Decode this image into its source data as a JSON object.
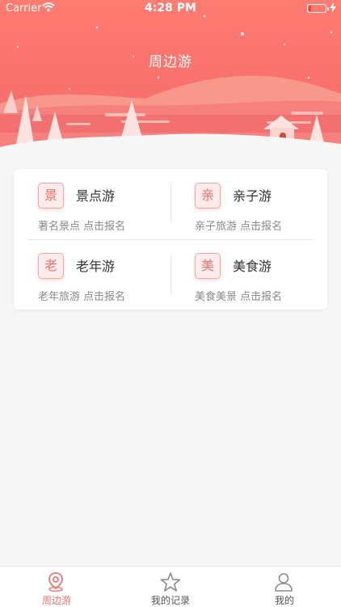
{
  "status_bar": {
    "carrier": "Carrier",
    "time": "4:28 PM"
  },
  "header": {
    "title": "周边游"
  },
  "categories": [
    {
      "badge": "景",
      "name": "景点游",
      "desc": "著名景点 点击报名"
    },
    {
      "badge": "亲",
      "name": "亲子游",
      "desc": "亲子旅游 点击报名"
    },
    {
      "badge": "老",
      "name": "老年游",
      "desc": "老年旅游 点击报名"
    },
    {
      "badge": "美",
      "name": "美食游",
      "desc": "美食美景 点击报名"
    }
  ],
  "tabbar": {
    "items": [
      {
        "label": "周边游",
        "icon": "location-pin-icon",
        "active": true
      },
      {
        "label": "我的记录",
        "icon": "star-icon",
        "active": false
      },
      {
        "label": "我的",
        "icon": "user-icon",
        "active": false
      }
    ]
  },
  "colors": {
    "accent": "#f0736c",
    "inactive": "#7a7a7a",
    "background": "#f6f6f7"
  }
}
